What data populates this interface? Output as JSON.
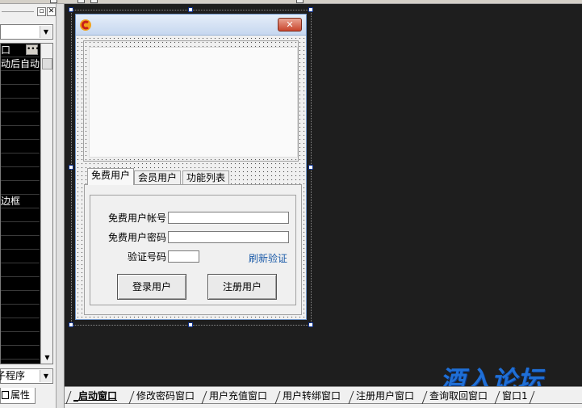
{
  "left_panel": {
    "rows": [
      {
        "text": "口"
      },
      {
        "text": "动后自动"
      },
      {
        "text": ""
      },
      {
        "text": ""
      },
      {
        "text": ""
      },
      {
        "text": ""
      },
      {
        "text": ""
      },
      {
        "text": ""
      },
      {
        "text": ""
      },
      {
        "text": ""
      },
      {
        "text": ""
      },
      {
        "text": "边框"
      },
      {
        "text": ""
      },
      {
        "text": ""
      },
      {
        "text": ""
      },
      {
        "text": ""
      },
      {
        "text": ""
      },
      {
        "text": ""
      },
      {
        "text": ""
      },
      {
        "text": ""
      },
      {
        "text": ""
      },
      {
        "text": ""
      },
      {
        "text": ""
      }
    ],
    "event_combo": "子程序",
    "tab_label": "属性"
  },
  "design_window": {
    "tabs": [
      "免费用户",
      "会员用户",
      "功能列表"
    ],
    "account_label": "免费用户帐号：",
    "password_label": "免费用户密码：",
    "captcha_label": "验证号码：",
    "refresh_link": "刷新验证",
    "login_button": "登录用户",
    "register_button": "注册用户",
    "close_symbol": "✕"
  },
  "watermark": "酒入论坛",
  "window_tabs": [
    {
      "label": "_启动窗口",
      "active": true
    },
    {
      "label": "修改密码窗口",
      "active": false
    },
    {
      "label": "用户充值窗口",
      "active": false
    },
    {
      "label": "用户转绑窗口",
      "active": false
    },
    {
      "label": "注册用户窗口",
      "active": false
    },
    {
      "label": "查询取回窗口",
      "active": false
    },
    {
      "label": "窗口1",
      "active": false
    }
  ],
  "colors": {
    "workspace_bg": "#1e1e1e",
    "link": "#1a5aa8",
    "watermark": "#1f6fd6",
    "handle_border": "#0b2e8a"
  }
}
